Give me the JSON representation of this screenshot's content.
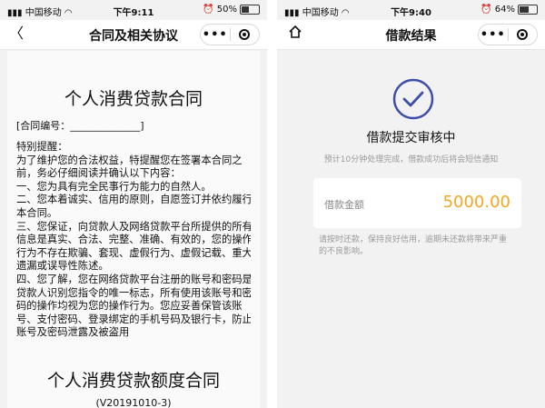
{
  "left": {
    "status": {
      "carrier": "中国移动",
      "time": "下午9:11",
      "battery": "50%",
      "battery_level": 0.5
    },
    "nav": {
      "title": "合同及相关协议"
    },
    "doc": {
      "title": "个人消费贷款合同",
      "contract_no": "[合同编号：______________]",
      "notice_lines": [
        "特别提醒：",
        "为了维护您的合法权益，特提醒您在签署本合同之",
        "前，务必仔细阅读并确认以下内容：",
        "一、您为具有完全民事行为能力的自然人。",
        "二、您本着诚实、信用的原则，自愿签订并依约履行",
        "本合同。",
        "三、您保证，向贷款人及网络贷款平台所提供的所有",
        "信息是真实、合法、完整、准确、有效的，您的操作",
        "行为不存在欺骗、套现、虚假行为、虚假记载、重大",
        "遗漏或误导性陈述。",
        "四、您了解，您在网络贷款平台注册的账号和密码是",
        "贷款人识别您指令的唯一标志，所有使用该账号和密",
        "码的操作均视为您的操作行为。您应妥善保管该账",
        "号、支付密码、登录绑定的手机号码及银行卡，防止",
        "账号及密码泄露及被盗用"
      ],
      "title2": "个人消费贷款额度合同",
      "version": "(V20191010-3)"
    }
  },
  "right": {
    "status": {
      "carrier": "中国移动",
      "time": "下午9:40",
      "battery": "64%",
      "battery_level": 0.64
    },
    "nav": {
      "title": "借款结果"
    },
    "result": {
      "title": "借款提交审核中",
      "desc": "预计10分钟处理完成，借款成功后将会短信通知",
      "amount_label": "借款金额",
      "amount": "5000.00",
      "tip": "请按时还款，保持良好信用，逾期未还款将带来严重的不良影响。"
    }
  },
  "icons": {
    "back": "back-arrow-icon",
    "home": "home-icon",
    "more": "more-dots-icon",
    "close": "mini-program-close-icon",
    "wifi": "wifi-icon",
    "signal": "signal-icon",
    "alarm": "alarm-icon",
    "battery": "battery-icon",
    "check": "check-circle-icon"
  },
  "colors": {
    "accent": "#3d4fa8",
    "amount": "#f5a623",
    "muted": "#9a9a9a"
  }
}
